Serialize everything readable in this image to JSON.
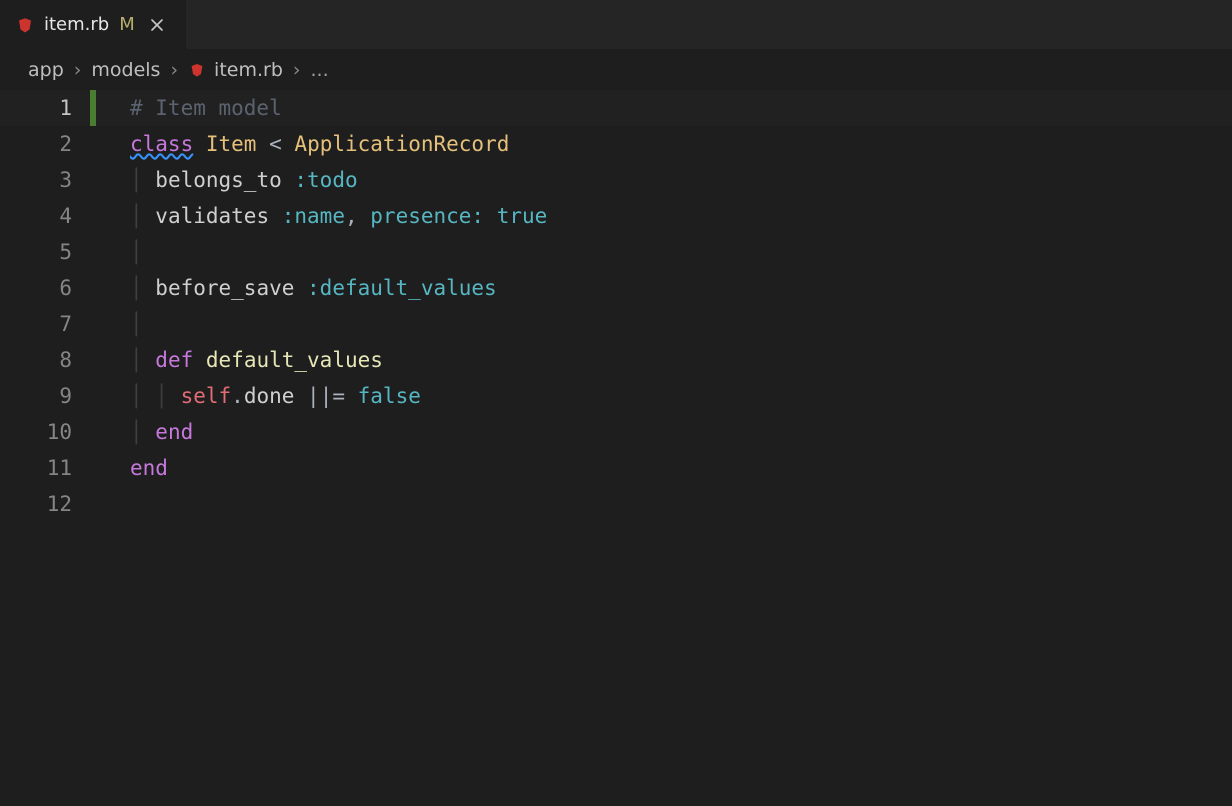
{
  "tab": {
    "title": "item.rb",
    "badge": "M"
  },
  "breadcrumb": {
    "items": [
      "app",
      "models",
      "item.rb"
    ],
    "ellipsis": "..."
  },
  "lines": {
    "l1": {
      "num": "1"
    },
    "l2": {
      "num": "2"
    },
    "l3": {
      "num": "3"
    },
    "l4": {
      "num": "4"
    },
    "l5": {
      "num": "5"
    },
    "l6": {
      "num": "6"
    },
    "l7": {
      "num": "7"
    },
    "l8": {
      "num": "8"
    },
    "l9": {
      "num": "9"
    },
    "l10": {
      "num": "10"
    },
    "l11": {
      "num": "11"
    },
    "l12": {
      "num": "12"
    }
  },
  "code": {
    "comment1": "# Item model",
    "kw_class": "class",
    "class_name": "Item",
    "lt": "<",
    "super_name": "ApplicationRecord",
    "belongs_to": "belongs_to",
    "sym_todo": ":todo",
    "validates": "validates",
    "sym_name": ":name",
    "comma": ",",
    "presence": "presence:",
    "true": "true",
    "before_save": "before_save",
    "sym_default_values": ":default_values",
    "kw_def": "def",
    "fn_default_values": "default_values",
    "self_kw": "self",
    "dot": ".",
    "done": "done",
    "oror_eq": "||=",
    "false": "false",
    "kw_end": "end"
  }
}
